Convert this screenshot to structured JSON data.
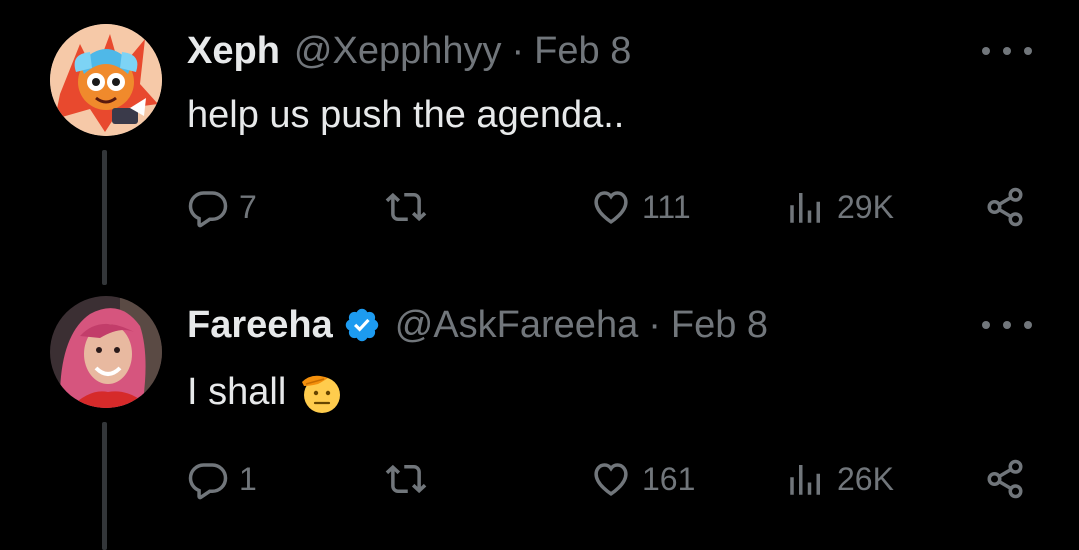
{
  "tweets": [
    {
      "author": {
        "display_name": "Xeph",
        "handle": "@Xepphhyy",
        "verified": false,
        "avatar": "cartoon-avatar"
      },
      "separator": "·",
      "date": "Feb 8",
      "text": "help us push the agenda..",
      "emoji": "",
      "stats": {
        "replies": "7",
        "retweets": "",
        "likes": "111",
        "views": "29K"
      }
    },
    {
      "author": {
        "display_name": "Fareeha",
        "handle": "@AskFareeha",
        "verified": true,
        "avatar": "photo-avatar"
      },
      "separator": "·",
      "date": "Feb 8",
      "text": "I shall",
      "emoji": "saluting-face",
      "stats": {
        "replies": "1",
        "retweets": "",
        "likes": "161",
        "views": "26K"
      }
    }
  ],
  "colors": {
    "background": "#000000",
    "primary_text": "#e7e9ea",
    "secondary_text": "#71767b",
    "verified_blue": "#1d9bf0",
    "thread_line": "#333639"
  },
  "icons": {
    "reply": "reply-icon",
    "retweet": "retweet-icon",
    "like": "heart-icon",
    "views": "views-icon",
    "share": "share-icon",
    "more": "more-options-icon",
    "verified": "verified-badge-icon"
  }
}
